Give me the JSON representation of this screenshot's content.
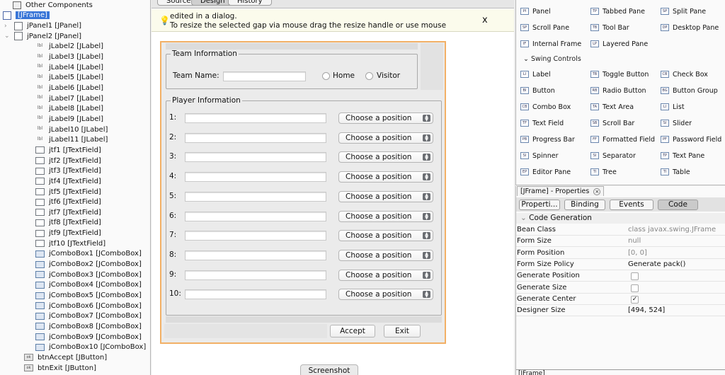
{
  "navigator": {
    "items": [
      {
        "label": "Other Components",
        "icon": "other-components-icon",
        "arrow": "",
        "indent": 18,
        "top": 0
      },
      {
        "label": "[JFrame]",
        "icon": "frame-icon",
        "arrow": "⌄",
        "indent": 4,
        "selected": true
      },
      {
        "label": "jPanel1 [JPanel]",
        "icon": "panel-icon",
        "arrow": "›",
        "indent": 20
      },
      {
        "label": "jPanel2 [JPanel]",
        "icon": "panel-icon",
        "arrow": "⌄",
        "indent": 20
      },
      {
        "label": "jLabel2 [JLabel]",
        "icon": "label-icon",
        "indent": 50
      },
      {
        "label": "jLabel3 [JLabel]",
        "icon": "label-icon",
        "indent": 50
      },
      {
        "label": "jLabel4 [JLabel]",
        "icon": "label-icon",
        "indent": 50
      },
      {
        "label": "jLabel5 [JLabel]",
        "icon": "label-icon",
        "indent": 50
      },
      {
        "label": "jLabel6 [JLabel]",
        "icon": "label-icon",
        "indent": 50
      },
      {
        "label": "jLabel7 [JLabel]",
        "icon": "label-icon",
        "indent": 50
      },
      {
        "label": "jLabel8 [JLabel]",
        "icon": "label-icon",
        "indent": 50
      },
      {
        "label": "jLabel9 [JLabel]",
        "icon": "label-icon",
        "indent": 50
      },
      {
        "label": "jLabel10 [JLabel]",
        "icon": "label-icon",
        "indent": 50
      },
      {
        "label": "jLabel11 [JLabel]",
        "icon": "label-icon",
        "indent": 50
      },
      {
        "label": "jtf1 [JTextField]",
        "icon": "textfield-icon",
        "indent": 50
      },
      {
        "label": "jtf2 [JTextField]",
        "icon": "textfield-icon",
        "indent": 50
      },
      {
        "label": "jtf3 [JTextField]",
        "icon": "textfield-icon",
        "indent": 50
      },
      {
        "label": "jtf4 [JTextField]",
        "icon": "textfield-icon",
        "indent": 50
      },
      {
        "label": "jtf5 [JTextField]",
        "icon": "textfield-icon",
        "indent": 50
      },
      {
        "label": "jtf6 [JTextField]",
        "icon": "textfield-icon",
        "indent": 50
      },
      {
        "label": "jtf7 [JTextField]",
        "icon": "textfield-icon",
        "indent": 50
      },
      {
        "label": "jtf8 [JTextField]",
        "icon": "textfield-icon",
        "indent": 50
      },
      {
        "label": "jtf9 [JTextField]",
        "icon": "textfield-icon",
        "indent": 50
      },
      {
        "label": "jtf10 [JTextField]",
        "icon": "textfield-icon",
        "indent": 50
      },
      {
        "label": "jComboBox1 [JComboBox]",
        "icon": "combobox-icon",
        "indent": 50
      },
      {
        "label": "jComboBox2 [JComboBox]",
        "icon": "combobox-icon",
        "indent": 50
      },
      {
        "label": "jComboBox3 [JComboBox]",
        "icon": "combobox-icon",
        "indent": 50
      },
      {
        "label": "jComboBox4 [JComboBox]",
        "icon": "combobox-icon",
        "indent": 50
      },
      {
        "label": "jComboBox5 [JComboBox]",
        "icon": "combobox-icon",
        "indent": 50
      },
      {
        "label": "jComboBox6 [JComboBox]",
        "icon": "combobox-icon",
        "indent": 50
      },
      {
        "label": "jComboBox7 [JComboBox]",
        "icon": "combobox-icon",
        "indent": 50
      },
      {
        "label": "jComboBox8 [JComboBox]",
        "icon": "combobox-icon",
        "indent": 50
      },
      {
        "label": "jComboBox9 [JComboBox]",
        "icon": "combobox-icon",
        "indent": 50
      },
      {
        "label": "jComboBox10 [JComboBox]",
        "icon": "combobox-icon",
        "indent": 50
      },
      {
        "label": "btnAccept [JButton]",
        "icon": "button-icon",
        "indent": 34
      },
      {
        "label": "btnExit [JButton]",
        "icon": "button-icon",
        "indent": 34
      }
    ]
  },
  "editor": {
    "tabs": [
      "Source",
      "Design",
      "History"
    ],
    "hint_line1": "edited in a dialog.",
    "hint_line2": "To resize the selected gap via mouse drag the resize handle or use mouse",
    "close_glyph": "x"
  },
  "form": {
    "team_legend": "Team Information",
    "team_name_label": "Team Name:",
    "radio_home": "Home",
    "radio_visitor": "Visitor",
    "player_legend": "Player Information",
    "rows": [
      {
        "num": "1:",
        "combo": "Choose a position"
      },
      {
        "num": "2:",
        "combo": "Choose a position"
      },
      {
        "num": "3:",
        "combo": "Choose a position"
      },
      {
        "num": "4:",
        "combo": "Choose a position"
      },
      {
        "num": "5:",
        "combo": "Choose a position"
      },
      {
        "num": "6:",
        "combo": "Choose a position"
      },
      {
        "num": "7:",
        "combo": "Choose a position"
      },
      {
        "num": "8:",
        "combo": "Choose a position"
      },
      {
        "num": "9:",
        "combo": "Choose a position"
      },
      {
        "num": "10:",
        "combo": "Choose a position"
      }
    ],
    "accept_label": "Accept",
    "exit_label": "Exit"
  },
  "screenshot_label": "Screenshot",
  "palette": {
    "containers": [
      {
        "label": "Panel",
        "icon": "panel-icon"
      },
      {
        "label": "Tabbed Pane",
        "icon": "tabbed-pane-icon"
      },
      {
        "label": "Split Pane",
        "icon": "split-pane-icon"
      },
      {
        "label": "Scroll Pane",
        "icon": "scroll-pane-icon"
      },
      {
        "label": "Tool Bar",
        "icon": "tool-bar-icon"
      },
      {
        "label": "Desktop Pane",
        "icon": "desktop-pane-icon"
      },
      {
        "label": "Internal Frame",
        "icon": "internal-frame-icon"
      },
      {
        "label": "Layered Pane",
        "icon": "layered-pane-icon"
      }
    ],
    "section_label": "Swing Controls",
    "controls": [
      {
        "label": "Label",
        "icon": "label-icon"
      },
      {
        "label": "Toggle Button",
        "icon": "toggle-button-icon"
      },
      {
        "label": "Check Box",
        "icon": "check-box-icon"
      },
      {
        "label": "Button",
        "icon": "button-icon"
      },
      {
        "label": "Radio Button",
        "icon": "radio-button-icon"
      },
      {
        "label": "Button Group",
        "icon": "button-group-icon"
      },
      {
        "label": "Combo Box",
        "icon": "combo-box-icon"
      },
      {
        "label": "Text Area",
        "icon": "text-area-icon"
      },
      {
        "label": "List",
        "icon": "list-icon"
      },
      {
        "label": "Text Field",
        "icon": "text-field-icon"
      },
      {
        "label": "Scroll Bar",
        "icon": "scroll-bar-icon"
      },
      {
        "label": "Slider",
        "icon": "slider-icon"
      },
      {
        "label": "Progress Bar",
        "icon": "progress-bar-icon"
      },
      {
        "label": "Formatted Field",
        "icon": "formatted-field-icon"
      },
      {
        "label": "Password Field",
        "icon": "password-field-icon"
      },
      {
        "label": "Spinner",
        "icon": "spinner-icon"
      },
      {
        "label": "Separator",
        "icon": "separator-icon"
      },
      {
        "label": "Text Pane",
        "icon": "text-pane-icon"
      },
      {
        "label": "Editor Pane",
        "icon": "editor-pane-icon"
      },
      {
        "label": "Tree",
        "icon": "tree-icon"
      },
      {
        "label": "Table",
        "icon": "table-icon"
      }
    ]
  },
  "properties": {
    "title": "[JFrame] - Properties",
    "tabs": [
      "Properti...",
      "Binding",
      "Events",
      "Code"
    ],
    "section": "Code Generation",
    "rows": [
      {
        "name": "Bean Class",
        "value": "class javax.swing.JFrame",
        "muted": true
      },
      {
        "name": "Form Size",
        "value": "null",
        "muted": true
      },
      {
        "name": "Form Position",
        "value": "[0, 0]",
        "muted": true
      },
      {
        "name": "Form Size Policy",
        "value": "Generate pack()"
      },
      {
        "name": "Generate Position",
        "checkbox": false
      },
      {
        "name": "Generate Size",
        "checkbox": false
      },
      {
        "name": "Generate Center",
        "checkbox": true
      },
      {
        "name": "Designer Size",
        "value": "[494, 524]"
      }
    ],
    "bottom": "[JFrame]"
  }
}
